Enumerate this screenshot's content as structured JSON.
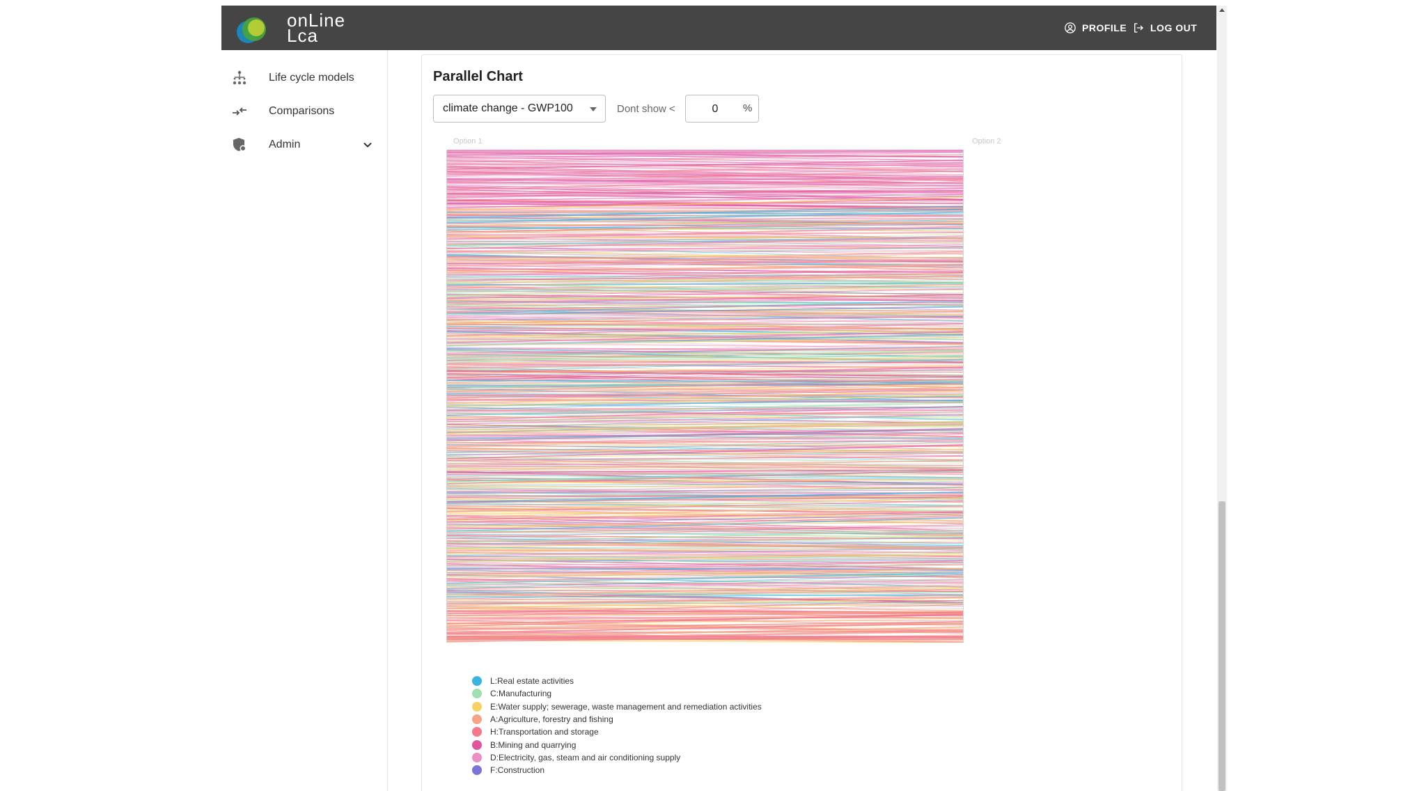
{
  "app": {
    "logo_line1": "onLine",
    "logo_line2": "Lca"
  },
  "header": {
    "profile_label": "PROFILE",
    "logout_label": "LOG OUT"
  },
  "sidebar": {
    "items": [
      {
        "label": "Life cycle models",
        "icon": "hierarchy-icon"
      },
      {
        "label": "Comparisons",
        "icon": "compare-arrows-icon"
      },
      {
        "label": "Admin",
        "icon": "admin-shield-icon",
        "expandable": true
      }
    ]
  },
  "main": {
    "card_title": "Parallel Chart",
    "impact_select": {
      "value": "climate change - GWP100"
    },
    "threshold": {
      "label": "Dont show <",
      "value": "0",
      "unit": "%"
    }
  },
  "chart_data": {
    "type": "parallel",
    "axes": [
      "Option 1",
      "Option 2"
    ],
    "legend": [
      {
        "label": "L:Real estate activities",
        "color": "#3bb4e3"
      },
      {
        "label": "C:Manufacturing",
        "color": "#9fe0b2"
      },
      {
        "label": "E:Water supply; sewerage, waste management and remediation activities",
        "color": "#f6d164"
      },
      {
        "label": "A:Agriculture, forestry and fishing",
        "color": "#f5a487"
      },
      {
        "label": "H:Transportation and storage",
        "color": "#f2788a"
      },
      {
        "label": "B:Mining and quarrying",
        "color": "#e0559c"
      },
      {
        "label": "D:Electricity, gas, steam and air conditioning supply",
        "color": "#e890c6"
      },
      {
        "label": "F:Construction",
        "color": "#7b73d6"
      }
    ]
  },
  "colors": {
    "header_bg": "#454545",
    "accent": "#3bb4e3"
  }
}
